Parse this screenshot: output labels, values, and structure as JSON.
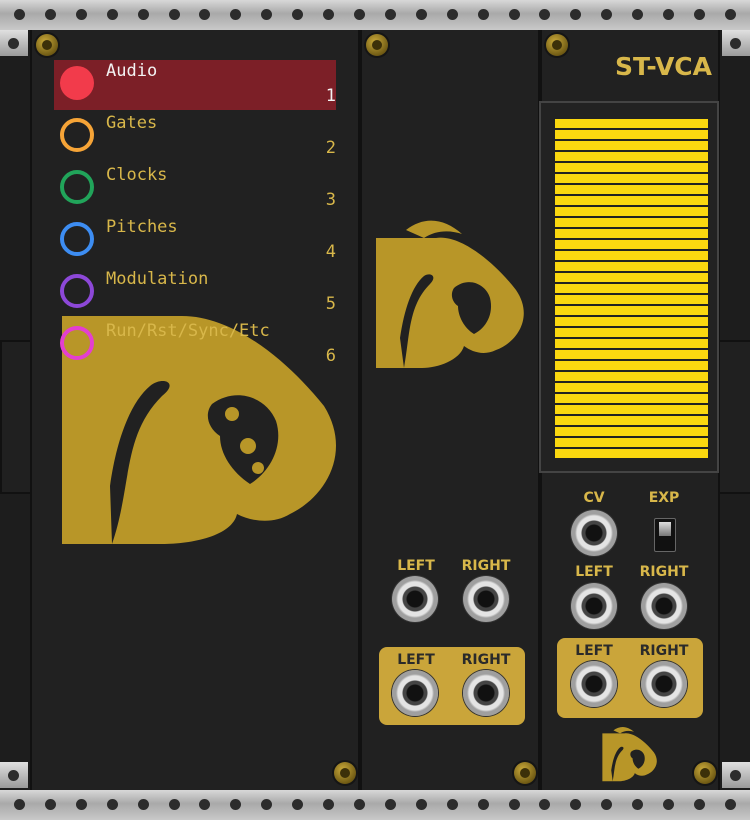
{
  "rack": {
    "colors": {
      "panel": "#212121",
      "gold": "#d8b74a",
      "meter": "#fbd80f"
    }
  },
  "legend": {
    "items": [
      {
        "label": "Audio",
        "number": "1",
        "color": "#f23b4b",
        "selected": true
      },
      {
        "label": "Gates",
        "number": "2",
        "color": "#f6a437",
        "selected": false
      },
      {
        "label": "Clocks",
        "number": "3",
        "color": "#21a45a",
        "selected": false
      },
      {
        "label": "Pitches",
        "number": "4",
        "color": "#3d8df2",
        "selected": false
      },
      {
        "label": "Modulation",
        "number": "5",
        "color": "#8d48d8",
        "selected": false
      },
      {
        "label": "Run/Rst/Sync/Etc",
        "number": "6",
        "color": "#e43fd0",
        "selected": false
      }
    ]
  },
  "io_module": {
    "row1": {
      "left_label": "LEFT",
      "right_label": "RIGHT"
    },
    "row2": {
      "left_label": "LEFT",
      "right_label": "RIGHT"
    }
  },
  "vca": {
    "title": "ST-VCA",
    "meter_level": 1.0,
    "cv_label": "CV",
    "exp_label": "EXP",
    "inputs": {
      "left_label": "LEFT",
      "right_label": "RIGHT"
    },
    "outputs": {
      "left_label": "LEFT",
      "right_label": "RIGHT"
    }
  },
  "icons": {
    "logo": "dragon-logo-icon",
    "screw": "screw-icon",
    "jack": "jack-socket-icon"
  }
}
